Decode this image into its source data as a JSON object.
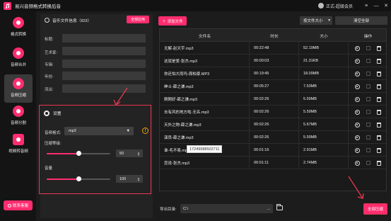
{
  "app": {
    "title": "易兴音频格式转换后音",
    "user_label": "正式-超级会员"
  },
  "window_controls": {
    "menu": "≡",
    "minimize": "—",
    "close": "✕"
  },
  "sidebar": {
    "items": [
      {
        "label": "格式转换",
        "icon": "music-note-icon",
        "active": false
      },
      {
        "label": "音频合并",
        "icon": "music-merge-icon",
        "active": false
      },
      {
        "label": "音频压缩",
        "icon": "music-compress-icon",
        "active": true
      },
      {
        "label": "音频分割",
        "icon": "music-split-icon",
        "active": false
      },
      {
        "label": "视频转音频",
        "icon": "video-to-audio-icon",
        "active": false
      }
    ],
    "support_button": "联系客服"
  },
  "info_panel": {
    "title": "音乐文件信息（ID3）",
    "edit_all_button": "全部应用",
    "fields": [
      {
        "label": "标题:",
        "value": ""
      },
      {
        "label": "艺术家:",
        "value": ""
      },
      {
        "label": "专辑:",
        "value": ""
      },
      {
        "label": "年份:",
        "value": ""
      },
      {
        "label": "流派:",
        "value": ""
      }
    ]
  },
  "settings": {
    "title": "设置",
    "format_label": "音频格式:",
    "format_value": "mp3",
    "compression_label": "压缩等级:",
    "compression_value": "50",
    "compression_fraction": 0.5,
    "volume_label": "音量",
    "volume_value": "100",
    "volume_fraction": 0.5
  },
  "toolbar": {
    "add_file": "添加文件",
    "sort_value": "按文件大小",
    "clear_all": "清空全部"
  },
  "table": {
    "headers": [
      "文件名",
      "时长",
      "大小",
      "操作"
    ],
    "rows": [
      {
        "name": "无解-赵天宇.mp3",
        "duration": "00:22:48",
        "size": "52.19MB"
      },
      {
        "name": "这就是爱-张杰.mp3",
        "duration": "00:00:03",
        "size": "21.31KB"
      },
      {
        "name": "你还怕大雨吗-周柏豪.MP3",
        "duration": "00:19:45",
        "size": "18.09MB"
      },
      {
        "name": "绅士-薛之谦.mp3",
        "duration": "00:05:27",
        "size": "7.53MB"
      },
      {
        "name": "刚刚好-薛之谦.mp3",
        "duration": "00:02:26",
        "size": "5.59MB"
      },
      {
        "name": "去有风的地方啦-无名.mp3",
        "duration": "00:02:26",
        "size": "5.59MB"
      },
      {
        "name": "天外之物-薛之谦.mp3",
        "duration": "00:02:26",
        "size": "5.67MB"
      },
      {
        "name": "演员-薛之谦.mp3",
        "duration": "00:02:26",
        "size": "5.59MB"
      },
      {
        "name": "谁-毛不易.mp3",
        "duration": "00:01:16",
        "size": "2.91MB"
      },
      {
        "name": "您说-张杰.mp3",
        "duration": "00:01:11",
        "size": "2.74MB"
      }
    ],
    "tooltip_row": 8,
    "tooltip_text": "17249988502711"
  },
  "footer": {
    "export_label": "导出目录:",
    "export_path": "C:\\",
    "export_more": "...",
    "compress_all": "全部压缩"
  },
  "colors": {
    "accent": "#ff2d6f",
    "highlight_border": "#e8374f",
    "warning": "#f0a500"
  }
}
